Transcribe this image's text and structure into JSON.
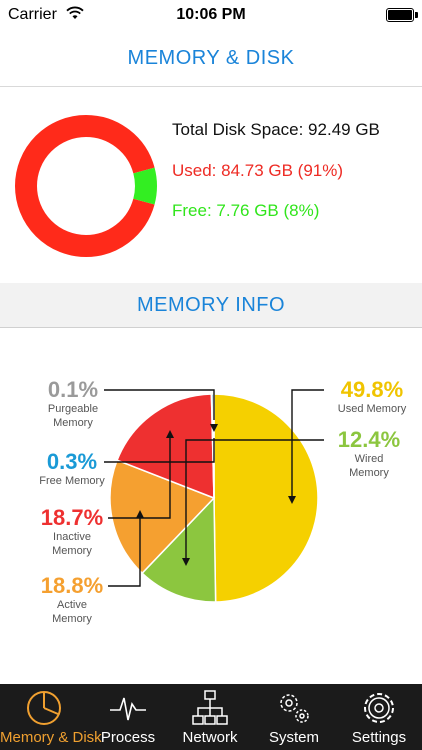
{
  "status_bar": {
    "carrier": "Carrier",
    "time": "10:06 PM"
  },
  "header": {
    "title": "MEMORY & DISK"
  },
  "disk": {
    "total_label": "Total Disk Space: 92.49 GB",
    "used_label": "Used: 84.73 GB (91%)",
    "free_label": "Free: 7.76 GB (8%)",
    "used_fraction": 0.916,
    "free_fraction": 0.084,
    "colors": {
      "used": "#ff2a1a",
      "free": "#33ee22"
    }
  },
  "memory_section": {
    "title": "MEMORY INFO"
  },
  "memory": {
    "purgeable": {
      "pct": "0.1%",
      "name1": "Purgeable",
      "name2": "Memory",
      "value": 0.1,
      "color": "#9a9a9a"
    },
    "free": {
      "pct": "0.3%",
      "name1": "Free Memory",
      "value": 0.3,
      "color": "#1a9ad6"
    },
    "inactive": {
      "pct": "18.7%",
      "name1": "Inactive",
      "name2": "Memory",
      "value": 18.7,
      "color": "#ee3030"
    },
    "active": {
      "pct": "18.8%",
      "name1": "Active",
      "name2": "Memory",
      "value": 18.8,
      "color": "#f5a030"
    },
    "used": {
      "pct": "49.8%",
      "name1": "Used Memory",
      "value": 49.8,
      "color": "#f5d000"
    },
    "wired": {
      "pct": "12.4%",
      "name1": "Wired",
      "name2": "Memory",
      "value": 12.4,
      "color": "#8cc63f"
    }
  },
  "tabs": [
    {
      "label": "Memory & Disk",
      "icon": "pie-chart-icon"
    },
    {
      "label": "Process",
      "icon": "pulse-icon"
    },
    {
      "label": "Network",
      "icon": "network-icon"
    },
    {
      "label": "System",
      "icon": "gears-icon"
    },
    {
      "label": "Settings",
      "icon": "gear-icon"
    }
  ]
}
